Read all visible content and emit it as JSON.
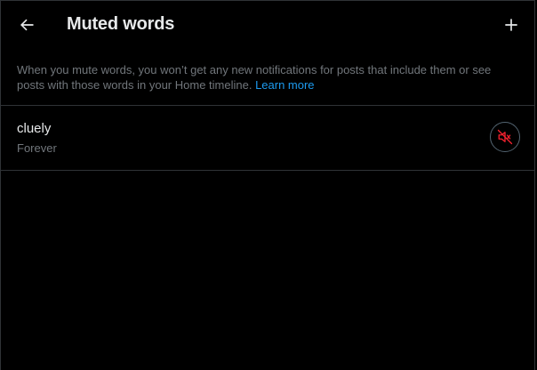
{
  "header": {
    "title": "Muted words",
    "back_icon": "arrow-left-icon",
    "add_icon": "plus-icon"
  },
  "description": {
    "text": "When you mute words, you won’t get any new notifications for posts that include them or see posts with those words in your Home timeline. ",
    "link": "Learn more"
  },
  "muted_words": [
    {
      "word": "cluely",
      "duration": "Forever",
      "icon": "speaker-muted-icon"
    }
  ],
  "colors": {
    "background": "#000000",
    "primary_text": "#e7e9ea",
    "secondary_text": "#71767b",
    "link": "#1d9bf0",
    "mute_icon": "#f4212e",
    "divider": "#2f3336"
  }
}
